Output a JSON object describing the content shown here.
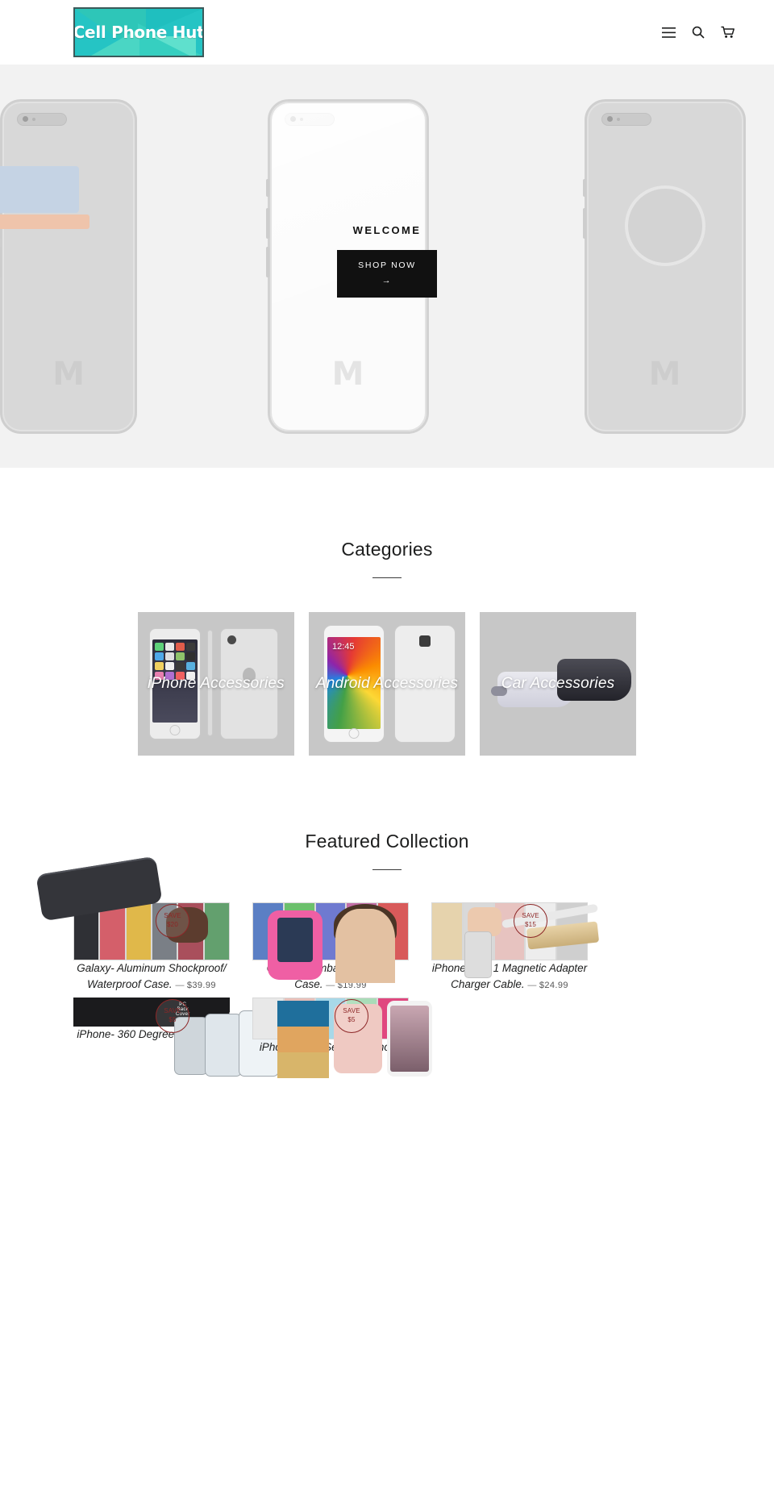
{
  "header": {
    "logo_text": "Cell Phone Hut",
    "icons": [
      {
        "name": "menu-icon",
        "label": "Menu"
      },
      {
        "name": "search-icon",
        "label": "Search"
      },
      {
        "name": "cart-icon",
        "label": "Cart"
      }
    ]
  },
  "hero": {
    "title": "WELCOME",
    "cta_label": "SHOP NOW",
    "cta_arrow": "→"
  },
  "categories": {
    "heading": "Categories",
    "items": [
      {
        "label": "iPhone Accessories"
      },
      {
        "label": "Android Accessories"
      },
      {
        "label": "Car Accessories"
      }
    ]
  },
  "featured": {
    "heading": "Featured Collection",
    "products": [
      {
        "title": "Galaxy- Aluminum Shockproof/ Waterproof Case.",
        "price": "$39.99",
        "dash": "—",
        "badge_line1": "SAVE",
        "badge_line2": "$20"
      },
      {
        "title": "Galaxy- Armband Workout Case.",
        "price": "$19.99",
        "dash": "—",
        "badge_line1": "",
        "badge_line2": ""
      },
      {
        "title": "iPhone- 2 in 1 Magnetic Adapter Charger Cable.",
        "price": "$24.99",
        "dash": "—",
        "badge_line1": "SAVE",
        "badge_line2": "$15"
      },
      {
        "title": "iPhone- 360 Degree Protection",
        "price": "",
        "dash": "",
        "badge_line1": "SAVE",
        "badge_line2": "$5"
      },
      {
        "title": "iPhone- LED Selfie Luminous",
        "price": "",
        "dash": "",
        "badge_line1": "SAVE",
        "badge_line2": "$5"
      }
    ]
  },
  "colors": {
    "logo_bg": "#25c4c4",
    "cta_bg": "#111111",
    "badge": "#8d2727",
    "text": "#1c1d1d",
    "hero_bg": "#f2f2f2"
  }
}
